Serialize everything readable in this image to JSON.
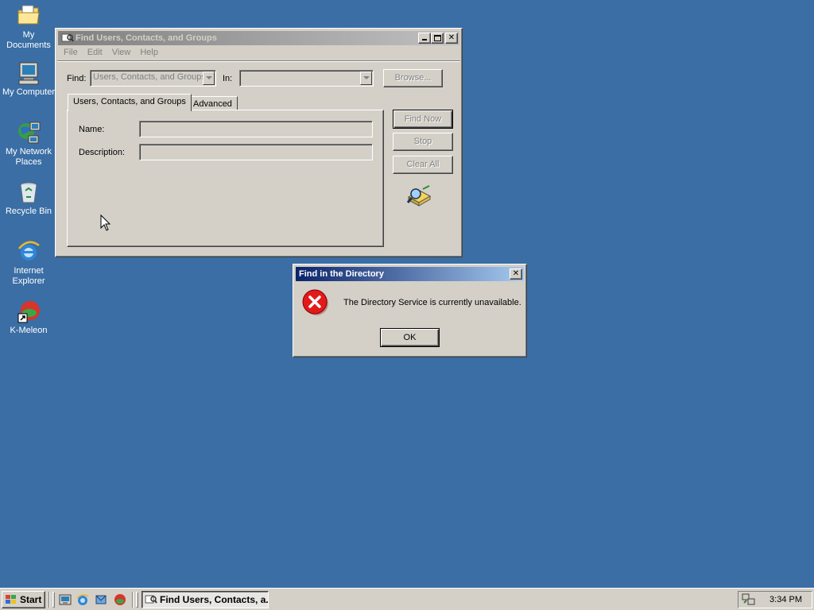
{
  "desktop": {
    "background": "#3a6ea5",
    "icons": [
      {
        "label": "My Documents",
        "icon": "folder-documents-icon"
      },
      {
        "label": "My Computer",
        "icon": "computer-icon"
      },
      {
        "label": "My Network Places",
        "icon": "network-icon"
      },
      {
        "label": "Recycle Bin",
        "icon": "recycle-bin-icon"
      },
      {
        "label": "Internet Explorer",
        "icon": "internet-explorer-icon"
      },
      {
        "label": "K-Meleon",
        "icon": "k-meleon-icon"
      }
    ]
  },
  "find_window": {
    "title": "Find Users, Contacts, and Groups",
    "menu": [
      "File",
      "Edit",
      "View",
      "Help"
    ],
    "find_label": "Find:",
    "find_value": "Users, Contacts, and Groups",
    "in_label": "In:",
    "in_value": "",
    "browse_label": "Browse...",
    "tabs": [
      "Users, Contacts, and Groups",
      "Advanced"
    ],
    "name_label": "Name:",
    "name_value": "",
    "description_label": "Description:",
    "description_value": "",
    "find_now_label": "Find Now",
    "stop_label": "Stop",
    "clear_all_label": "Clear All"
  },
  "error_dialog": {
    "title": "Find in the Directory",
    "message": "The Directory Service is currently unavailable.",
    "ok_label": "OK",
    "icon": "error-icon",
    "accent": "#0a246a"
  },
  "taskbar": {
    "start_label": "Start",
    "quick_launch": [
      "show-desktop-icon",
      "internet-explorer-icon",
      "outlook-express-icon",
      "k-meleon-icon"
    ],
    "task_label": "Find Users, Contacts, a...",
    "clock": "3:34 PM"
  }
}
